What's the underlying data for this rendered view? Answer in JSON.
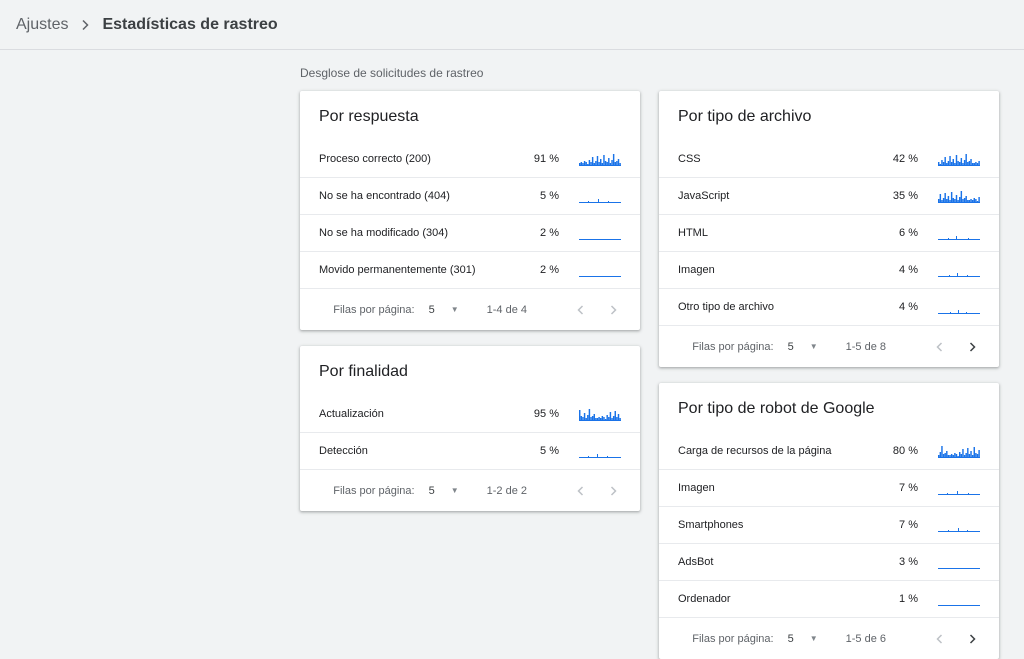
{
  "breadcrumb": {
    "root": "Ajustes",
    "current": "Estadísticas de rastreo"
  },
  "section_title": "Desglose de solicitudes de rastreo",
  "colors": {
    "accent": "#1a73e8",
    "text": "#202124",
    "muted": "#5f6368",
    "divider": "#e8eaed"
  },
  "cards": {
    "respuesta": {
      "title": "Por respuesta",
      "rows": [
        {
          "label": "Proceso correcto (200)",
          "pct": "91 %",
          "spark": "high"
        },
        {
          "label": "No se ha encontrado (404)",
          "pct": "5 %",
          "spark": "low"
        },
        {
          "label": "No se ha modificado (304)",
          "pct": "2 %",
          "spark": "flat"
        },
        {
          "label": "Movido permanentemente (301)",
          "pct": "2 %",
          "spark": "flat"
        }
      ],
      "footer": {
        "rows_label": "Filas por página:",
        "rows_value": "5",
        "range": "1-4 de 4",
        "next_enabled": false
      }
    },
    "finalidad": {
      "title": "Por finalidad",
      "rows": [
        {
          "label": "Actualización",
          "pct": "95 %",
          "spark": "high"
        },
        {
          "label": "Detección",
          "pct": "5 %",
          "spark": "low"
        }
      ],
      "footer": {
        "rows_label": "Filas por página:",
        "rows_value": "5",
        "range": "1-2 de 2",
        "next_enabled": false
      }
    },
    "archivo": {
      "title": "Por tipo de archivo",
      "rows": [
        {
          "label": "CSS",
          "pct": "42 %",
          "spark": "high"
        },
        {
          "label": "JavaScript",
          "pct": "35 %",
          "spark": "high"
        },
        {
          "label": "HTML",
          "pct": "6 %",
          "spark": "low"
        },
        {
          "label": "Imagen",
          "pct": "4 %",
          "spark": "low"
        },
        {
          "label": "Otro tipo de archivo",
          "pct": "4 %",
          "spark": "low"
        }
      ],
      "footer": {
        "rows_label": "Filas por página:",
        "rows_value": "5",
        "range": "1-5 de 8",
        "next_enabled": true
      }
    },
    "robot": {
      "title": "Por tipo de robot de Google",
      "rows": [
        {
          "label": "Carga de recursos de la página",
          "pct": "80 %",
          "spark": "high"
        },
        {
          "label": "Imagen",
          "pct": "7 %",
          "spark": "low"
        },
        {
          "label": "Smartphones",
          "pct": "7 %",
          "spark": "low"
        },
        {
          "label": "AdsBot",
          "pct": "3 %",
          "spark": "flat"
        },
        {
          "label": "Ordenador",
          "pct": "1 %",
          "spark": "flat"
        }
      ],
      "footer": {
        "rows_label": "Filas por página:",
        "rows_value": "5",
        "range": "1-5 de 6",
        "next_enabled": true
      }
    }
  }
}
